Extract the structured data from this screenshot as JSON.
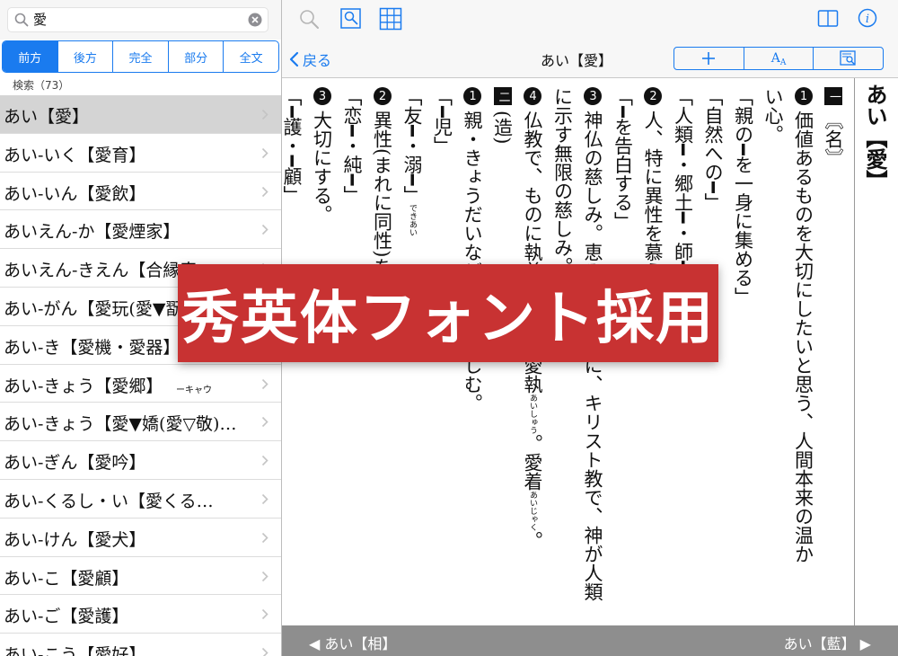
{
  "search": {
    "query": "愛",
    "modes": [
      "前方",
      "後方",
      "完全",
      "部分",
      "全文"
    ],
    "active_mode": "前方",
    "count_label": "検索（73）"
  },
  "results": [
    {
      "text": "あい【愛】",
      "note": ""
    },
    {
      "text": "あい‐いく【愛育】",
      "note": ""
    },
    {
      "text": "あい‐いん【愛飲】",
      "note": ""
    },
    {
      "text": "あいえん‐か【愛煙家】",
      "note": ""
    },
    {
      "text": "あいえん‐きえん【合縁奇…",
      "note": ""
    },
    {
      "text": "あい‐がん【愛玩(愛▼翫)】",
      "note": ""
    },
    {
      "text": "あい‐き【愛機・愛器】",
      "note": ""
    },
    {
      "text": "あい‐きょう【愛郷】",
      "note": "ーキャウ"
    },
    {
      "text": "あい‐きょう【愛▼嬌(愛▽敬)…",
      "note": ""
    },
    {
      "text": "あい‐ぎん【愛吟】",
      "note": ""
    },
    {
      "text": "あい‐くるし・い【愛くる…",
      "note": ""
    },
    {
      "text": "あい‐けん【愛犬】",
      "note": ""
    },
    {
      "text": "あい‐こ【愛顧】",
      "note": ""
    },
    {
      "text": "あい‐ご【愛護】",
      "note": ""
    },
    {
      "text": "あい‐こう【愛好】",
      "note": ""
    }
  ],
  "navbar": {
    "back_label": "戻る",
    "title": "あい【愛】",
    "font_size_label_big": "A",
    "font_size_label_small": "A"
  },
  "entry": {
    "headword": "あい【愛】",
    "lines": [
      {
        "mark": "一",
        "mark_type": "box",
        "text": "〘名〙"
      },
      {
        "mark": "1",
        "mark_type": "dot",
        "text": "価値あるものを大切にしたいと思う、人間本来の温か"
      },
      {
        "mark": "",
        "mark_type": "",
        "text": "い心。"
      },
      {
        "mark": "",
        "mark_type": "",
        "text": "「親の━を一身に集める」"
      },
      {
        "mark": "",
        "mark_type": "",
        "text": "「自然への━」"
      },
      {
        "mark": "",
        "mark_type": "",
        "text": "「人類━・郷土━・師━」"
      },
      {
        "mark": "2",
        "mark_type": "dot",
        "text": "人、特に異性を慕う心。恋。"
      },
      {
        "mark": "",
        "mark_type": "",
        "text": "「━を告白する」"
      },
      {
        "mark": "3",
        "mark_type": "dot",
        "text": "神仏の慈しみ。恵みの心。特に、キリスト教で、神が人類"
      },
      {
        "mark": "",
        "mark_type": "",
        "text": "に示す無限の慈しみ。アガペー。"
      },
      {
        "mark": "4",
        "mark_type": "dot",
        "text": "仏教で、ものに執着する心。愛執",
        "ruby1": "あいしゅう",
        "tail": "。愛着",
        "ruby2": "あいじゃく",
        "end": "。"
      },
      {
        "mark": "二",
        "mark_type": "box",
        "text": "(造)"
      },
      {
        "mark": "1",
        "mark_type": "dot",
        "text": "親・きょうだいなどをいとおしむ。"
      },
      {
        "mark": "",
        "mark_type": "",
        "text": "「━児」"
      },
      {
        "mark": "",
        "mark_type": "",
        "text": "「友━・溺━」",
        "ruby1": "できあい"
      },
      {
        "mark": "2",
        "mark_type": "dot",
        "text": "異性(まれに同性)を慕う。"
      },
      {
        "mark": "",
        "mark_type": "",
        "text": "「恋━・純━」"
      },
      {
        "mark": "3",
        "mark_type": "dot",
        "text": "大切にする。"
      },
      {
        "mark": "",
        "mark_type": "",
        "text": "「━護・━顧」"
      }
    ]
  },
  "footer": {
    "prev_label": "◀ あい【相】",
    "next_label": "あい【藍】 ▶"
  },
  "banner": {
    "text": "秀英体フォント採用"
  },
  "colors": {
    "accent": "#1a7bef",
    "banner": "#c83232",
    "footer": "#8e8e8e"
  }
}
